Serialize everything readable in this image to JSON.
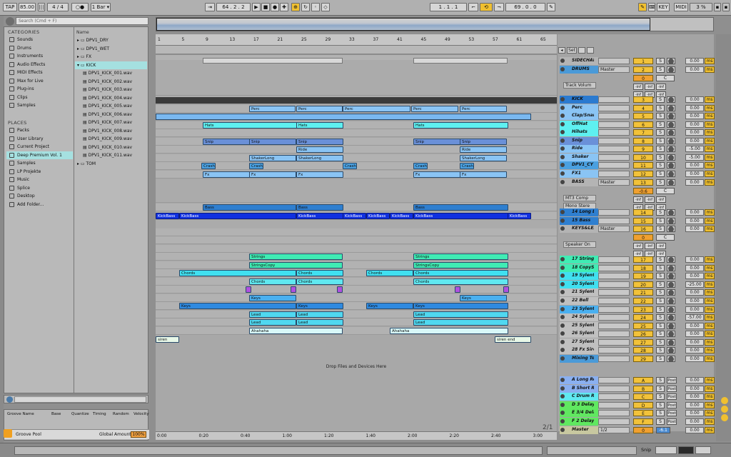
{
  "transport": {
    "tap": "TAP",
    "tempo": "85.00",
    "sig_num": "4",
    "sig_den": "4",
    "metro": "○●",
    "quant": "1 Bar",
    "pos_bar": "64",
    "pos_beat": "2",
    "pos_sixteenth": "2",
    "loop_bar": "1",
    "loop_beat": "1",
    "loop_sixteenth": "1",
    "len_bar": "69",
    "len_beat": "0",
    "len_sixteenth": "0",
    "key": "KEY",
    "midi": "MIDI",
    "cpu": "3 %"
  },
  "browser": {
    "search_placeholder": "Search (Cmd + F)",
    "categories_header": "CATEGORIES",
    "categories": [
      "Sounds",
      "Drums",
      "Instruments",
      "Audio Effects",
      "MIDI Effects",
      "Max for Live",
      "Plug-ins",
      "Clips",
      "Samples"
    ],
    "places_header": "PLACES",
    "places": [
      "Packs",
      "User Library",
      "Current Project",
      "Deep Premium Vol. 1",
      "Samples",
      "LP Projekte",
      "Music",
      "Splice",
      "Desktop",
      "Add Folder..."
    ],
    "name_header": "Name",
    "folders_top": [
      "DPV1_DRY",
      "DPV1_WET",
      "FX",
      "KICK"
    ],
    "kick_files": [
      "DPV1_KICK_001.wav",
      "DPV1_KICK_002.wav",
      "DPV1_KICK_003.wav",
      "DPV1_KICK_004.wav",
      "DPV1_KICK_005.wav",
      "DPV1_KICK_006.wav",
      "DPV1_KICK_007.wav",
      "DPV1_KICK_008.wav",
      "DPV1_KICK_009.wav",
      "DPV1_KICK_010.wav",
      "DPV1_KICK_011.wav"
    ],
    "folder_after": "TOM"
  },
  "groove": {
    "cols": [
      "Groove Name",
      "Base",
      "Quantize",
      "Timing",
      "Random",
      "Velocity"
    ],
    "pool": "Groove Pool",
    "global_amount_label": "Global Amount",
    "global_amount": "100%"
  },
  "ruler_bars": [
    "1",
    "5",
    "9",
    "13",
    "17",
    "21",
    "25",
    "29",
    "33",
    "37",
    "41",
    "45",
    "49",
    "53",
    "57",
    "61",
    "65"
  ],
  "time_ruler": [
    "0:00",
    "0:20",
    "0:40",
    "1:00",
    "1:20",
    "1:40",
    "2:00",
    "2:20",
    "2:40",
    "3:00"
  ],
  "drop_text": "Drop Files and Devices Here",
  "page_indicator": "2/1",
  "set_label": "Set",
  "tracks": [
    {
      "name": "SIDECHAIN",
      "num": "1"
    },
    {
      "name": "DRUMS",
      "num": "2",
      "routing": "Master",
      "sub": "0",
      "device": "Track Volum"
    },
    {
      "name": "KICK",
      "num": "3"
    },
    {
      "name": "Perc",
      "num": "4"
    },
    {
      "name": "Clap/Snare",
      "num": "5"
    },
    {
      "name": "OffHat",
      "num": "6"
    },
    {
      "name": "Hihats",
      "num": "7"
    },
    {
      "name": "Snip",
      "num": "8"
    },
    {
      "name": "Ride",
      "num": "9",
      "vol": "-5.00"
    },
    {
      "name": "Shaker",
      "num": "10",
      "vol": "-5.00"
    },
    {
      "name": "DPV1_CY",
      "num": "11"
    },
    {
      "name": "FX1",
      "num": "12"
    },
    {
      "name": "BASS",
      "num": "13",
      "routing": "Master",
      "sub": "-0.6",
      "device": "MT3 Comp",
      "device2": "Mono Stere"
    },
    {
      "name": "14 Long B",
      "num": "14"
    },
    {
      "name": "15 Bass",
      "num": "15"
    },
    {
      "name": "KEYS&LEAD",
      "num": "16",
      "routing": "Master",
      "sub": "0",
      "device": "Speaker On"
    },
    {
      "name": "17 Strings",
      "num": "17"
    },
    {
      "name": "18 CopyS",
      "num": "18"
    },
    {
      "name": "19 Sylenth",
      "num": "19"
    },
    {
      "name": "20 Sylenth",
      "num": "20",
      "vol": "-25.00"
    },
    {
      "name": "21 Sylenth",
      "num": "21"
    },
    {
      "name": "22 Bell",
      "num": "22"
    },
    {
      "name": "23 Sylenth",
      "num": "23"
    },
    {
      "name": "24 Sylenth",
      "num": "24",
      "vol": "-57.00"
    },
    {
      "name": "25 Sylenth",
      "num": "25"
    },
    {
      "name": "26 Sylenth",
      "num": "26"
    },
    {
      "name": "27 Sylenth",
      "num": "27"
    },
    {
      "name": "28 Fx Sire",
      "num": "28"
    },
    {
      "name": "Mixing Tool",
      "num": "29"
    }
  ],
  "returns": [
    {
      "name": "A Long Reve",
      "num": "A"
    },
    {
      "name": "B Short Rev",
      "num": "B"
    },
    {
      "name": "C Drum Rev",
      "num": "C"
    },
    {
      "name": "D 3 Delay",
      "num": "D"
    },
    {
      "name": "E 3/4 Delay",
      "num": "E"
    },
    {
      "name": "F 2 Delay",
      "num": "F"
    }
  ],
  "master": {
    "name": "Master",
    "num": "0",
    "routing": "1/2",
    "vol": "-6.1"
  },
  "mixer_labels": {
    "solo": "S",
    "vol_default": "0.00",
    "ms": "ms",
    "post": "Post",
    "inf": "-inf",
    "c": "C"
  },
  "clips": [
    {
      "lane": 3,
      "items": [
        "Perc",
        "Perc",
        "Perc",
        "Perc",
        "Perc"
      ]
    },
    {
      "lane": 5,
      "items": [
        "Hats",
        "Hats",
        "Hats"
      ]
    },
    {
      "lane": 6,
      "items": [
        "Snip",
        "Snip",
        "Snip",
        "Snip",
        "Snip",
        "Snip"
      ]
    },
    {
      "lane": 7,
      "items": [
        "Ride",
        "Ride"
      ]
    },
    {
      "lane": 8,
      "items": [
        "ShakerLong",
        "ShakerLong",
        "ShakerLong"
      ]
    },
    {
      "lane": 9,
      "items": [
        "Crash",
        "Crash",
        "Crash",
        "Crash",
        "Crash"
      ]
    },
    {
      "lane": 10,
      "items": [
        "Fx",
        "Fx",
        "Fx",
        "Fx",
        "Fx"
      ]
    },
    {
      "lane": 12,
      "items": [
        "Bass",
        "Bass",
        "Bass"
      ]
    },
    {
      "lane": 13,
      "items": [
        "KickBass",
        "KickBass",
        "KickBass",
        "KickBass",
        "KickBass",
        "KickBass",
        "KickBass",
        "KickBass"
      ]
    },
    {
      "lane": 15,
      "items": [
        "Strings",
        "Strings"
      ]
    },
    {
      "lane": 16,
      "items": [
        "StringsCopy",
        "StringsCopy"
      ]
    },
    {
      "lane": 17,
      "items": [
        "Chords",
        "Chords",
        "Chords",
        "Chords"
      ]
    },
    {
      "lane": 18,
      "items": [
        "Chords",
        "Chords",
        "Chords"
      ]
    },
    {
      "lane": 20,
      "items": [
        "Keys",
        "Keys"
      ]
    },
    {
      "lane": 21,
      "items": [
        "Keys",
        "Keys",
        "Keys",
        "Keys"
      ]
    },
    {
      "lane": 22,
      "items": [
        "Lead",
        "Lead",
        "Lead"
      ]
    },
    {
      "lane": 23,
      "items": [
        "Lead",
        "Lead",
        "Lead"
      ]
    },
    {
      "lane": 24,
      "items": [
        "Ahahaha",
        "Ahahaha"
      ]
    },
    {
      "lane": 25,
      "items": [
        "siren",
        "siren end"
      ]
    }
  ],
  "footer": {
    "snip": "Snip"
  },
  "colors": {
    "accent": "#f0c030",
    "clip_blue": "#7ab8f0",
    "clip_cyan": "#5ee8e8",
    "clip_green": "#40e8b0",
    "clip_dark_blue": "#2060c0",
    "clip_purple": "#b050e0"
  }
}
